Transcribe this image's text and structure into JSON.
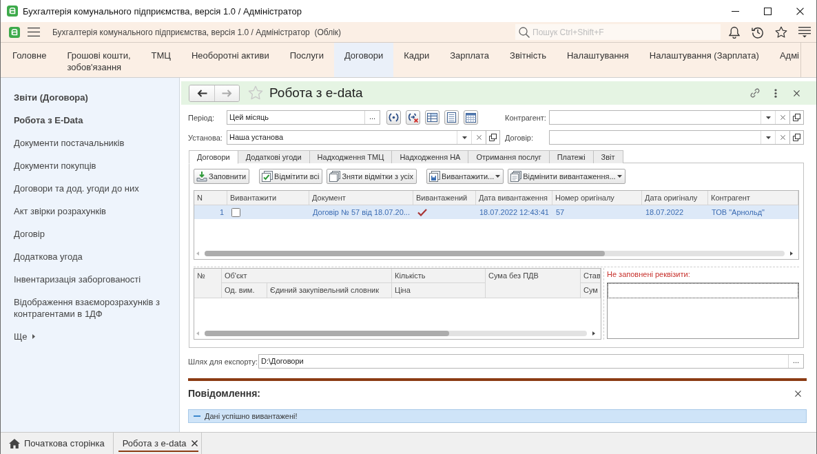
{
  "window": {
    "title": "Бухгалтерія комунального підприємства, версія 1.0 / Адміністратор"
  },
  "app_bar": {
    "title": "Бухгалтерія комунального підприємства, версія 1.0 / Адміністратор  (Облік)",
    "search": {
      "placeholder": "Пошук Ctrl+Shift+F"
    }
  },
  "sections": [
    {
      "label": "Головне",
      "selected": false
    },
    {
      "label": "Грошові кошти,\nзобов'язання",
      "selected": false
    },
    {
      "label": "ТМЦ",
      "selected": false
    },
    {
      "label": "Необоротні активи",
      "selected": false
    },
    {
      "label": "Послуги",
      "selected": false
    },
    {
      "label": "Договори",
      "selected": true
    },
    {
      "label": "Кадри",
      "selected": false
    },
    {
      "label": "Зарплата",
      "selected": false
    },
    {
      "label": "Звітність",
      "selected": false
    },
    {
      "label": "Налаштування",
      "selected": false
    },
    {
      "label": "Налаштування (Зарплата)",
      "selected": false
    },
    {
      "label": "Адмі",
      "selected": false
    }
  ],
  "sidebar": {
    "items": [
      {
        "label": "Звіти (Договора)",
        "kind": "heading"
      },
      {
        "label": "Робота з E-Data",
        "kind": "heading"
      },
      {
        "label": "Документи постачальників",
        "kind": "link"
      },
      {
        "label": "Документи покупців",
        "kind": "link"
      },
      {
        "label": "Договори та дод. угоди до них",
        "kind": "link"
      },
      {
        "label": "Акт звірки розрахунків",
        "kind": "link"
      },
      {
        "label": "Договір",
        "kind": "link"
      },
      {
        "label": "Додаткова угода",
        "kind": "link"
      },
      {
        "label": "Інвентаризація заборгованості",
        "kind": "link"
      },
      {
        "label": "Відображення взаєморозрахунків з контрагентами в 1ДФ",
        "kind": "link"
      },
      {
        "label": "Ще",
        "kind": "more"
      }
    ]
  },
  "form": {
    "title": "Робота з e-data",
    "filters": [
      {
        "label": "Період:",
        "value": "Цей місяць",
        "kind": "period",
        "button": "..."
      },
      {
        "label": "Контрагент:",
        "kind": "select"
      },
      {
        "label": "Установа:",
        "value": "Наша установа",
        "kind": "select"
      },
      {
        "label": "Договір:",
        "kind": "select"
      }
    ],
    "tabs": [
      {
        "label": "Договори",
        "selected": true
      },
      {
        "label": "Додаткові угоди",
        "selected": false
      },
      {
        "label": "Надходження ТМЦ",
        "selected": false
      },
      {
        "label": "Надходження НА",
        "selected": false
      },
      {
        "label": "Отримання послуг",
        "selected": false
      },
      {
        "label": "Платежі",
        "selected": false
      },
      {
        "label": "Звіт",
        "selected": false
      }
    ],
    "command_groups": [
      [
        {
          "label": "Заповнити",
          "kind": "button"
        }
      ],
      [
        {
          "label": "Відмітити всі",
          "kind": "button"
        },
        {
          "label": "Зняти відмітки з усіх",
          "kind": "button"
        }
      ],
      [
        {
          "label": "Вивантажити...",
          "kind": "menu"
        },
        {
          "label": "Відмінити вивантаження...",
          "kind": "menu"
        }
      ]
    ],
    "documents": {
      "columns": [
        "N",
        "Вивантажити",
        "Документ",
        "Вивантажений",
        "Дата вивантаження",
        "Номер оригіналу",
        "Дата оригіналу",
        "Контрагент"
      ],
      "rows": [
        {
          "selected": true,
          "number": "1",
          "export": false,
          "document": "Договір № 57 від 18.07.20...",
          "exported": true,
          "export_date": "18.07.2022 12:43:41",
          "original_number": "57",
          "original_date": "18.07.2022",
          "counterparty": "ТОВ \"Арнольд\""
        }
      ]
    },
    "items": {
      "columns": [
        {
          "label": "№"
        },
        {
          "label": "Об'єкт",
          "children": [
            {
              "label": "Од. вим."
            },
            {
              "label": "Єдиний закупівельний словник"
            }
          ]
        },
        {
          "label": "Кількість",
          "children": [
            {
              "label": "Ціна"
            }
          ]
        },
        {
          "label": "Сума без ПДВ"
        },
        {
          "label": "Став",
          "children": [
            {
              "label": "Сум"
            }
          ]
        }
      ]
    },
    "missing": {
      "label": "Не заповнені реквізити:"
    },
    "export_path": {
      "label": "Шлях для експорту:",
      "value": "D:\\Договори",
      "button": "..."
    }
  },
  "messages": {
    "title": "Повідомлення:",
    "items": [
      {
        "text": "Дані успішно вивантажені!"
      }
    ]
  },
  "open_tabs": [
    {
      "label": "Початкова сторінка",
      "kind": "home",
      "selected": false
    },
    {
      "label": "Робота з e-data",
      "kind": "form",
      "selected": true
    }
  ]
}
